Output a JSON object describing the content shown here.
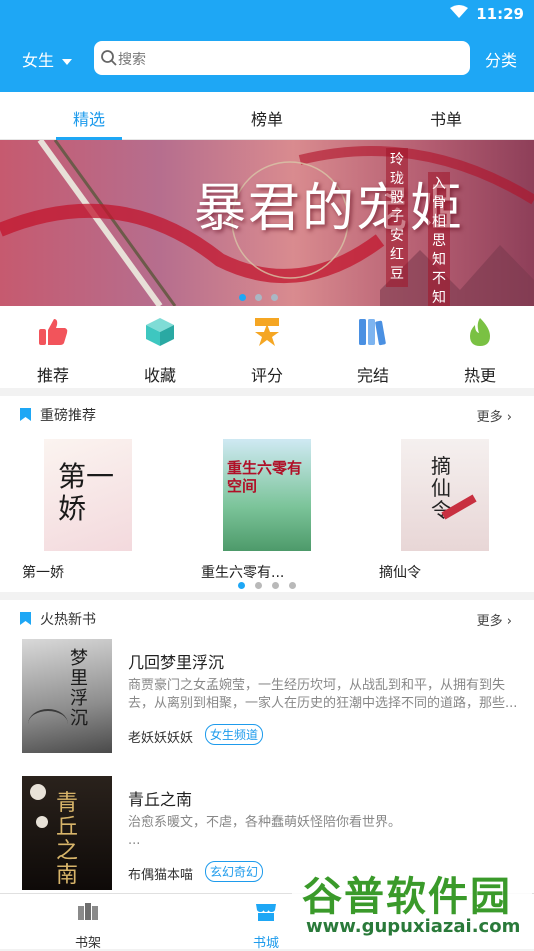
{
  "status": {
    "time": "11:29"
  },
  "header": {
    "gender_label": "女生",
    "search_placeholder": "搜索",
    "category_label": "分类"
  },
  "tabs": [
    {
      "label": "精选",
      "active": true
    },
    {
      "label": "榜单",
      "active": false
    },
    {
      "label": "书单",
      "active": false
    }
  ],
  "banner": {
    "title": "暴君的宠姬",
    "vertical_text_1": "玲珑骰子安红豆",
    "vertical_text_2": "入骨相思知不知",
    "slide_count": 3,
    "active_slide": 0
  },
  "quick_nav": [
    {
      "label": "推荐",
      "icon": "thumbs-up-icon",
      "color": "#f2545b"
    },
    {
      "label": "收藏",
      "icon": "cube-icon",
      "color": "#3ec7c0"
    },
    {
      "label": "评分",
      "icon": "star-badge-icon",
      "color": "#f5a623"
    },
    {
      "label": "完结",
      "icon": "books-icon",
      "color": "#4a90e2"
    },
    {
      "label": "热更",
      "icon": "flame-icon",
      "color": "#7ac143"
    }
  ],
  "featured": {
    "title": "重磅推荐",
    "more": "更多",
    "books": [
      {
        "name": "第一娇",
        "cover_text": "第一娇"
      },
      {
        "name": "重生六零有...",
        "cover_text": "重生六零有空间"
      },
      {
        "name": "摘仙令",
        "cover_text": "摘仙令"
      }
    ],
    "page_count": 4,
    "active_page": 0
  },
  "new_hot": {
    "title": "火热新书",
    "more": "更多",
    "books": [
      {
        "title": "几回梦里浮沉",
        "desc": "商贾豪门之女孟婉莹，一生经历坎坷，从战乱到和平，从拥有到失去，从离别到相聚，一家人在历史的狂潮中选择不同的道路，那些...",
        "author": "老妖妖妖妖",
        "tag": "女生频道",
        "cover_text": "梦里浮沉"
      },
      {
        "title": "青丘之南",
        "desc": "治愈系暖文，不虐，各种蠢萌妖怪陪你看世界。\n...",
        "author": "布偶猫本喵",
        "tag": "玄幻奇幻",
        "cover_text": "青丘之南"
      }
    ]
  },
  "bottom_nav": [
    {
      "label": "书架",
      "active": false
    },
    {
      "label": "书城",
      "active": true
    }
  ],
  "watermark": {
    "line1": "谷普软件园",
    "line2": "www.gupuxiazai.com"
  },
  "colors": {
    "primary": "#1ea7f5",
    "accent_text": "#1e9bec"
  }
}
